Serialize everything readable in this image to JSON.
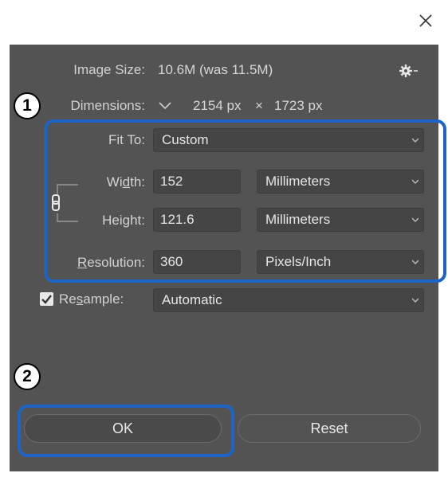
{
  "window": {
    "close_icon": "close-icon"
  },
  "image_size": {
    "label": "Image Size:",
    "value": "10.6M (was 11.5M)"
  },
  "dimensions": {
    "label": "Dimensions:",
    "width": "2154 px",
    "times": "×",
    "height": "1723 px"
  },
  "fit_to": {
    "label": "Fit To:",
    "value": "Custom"
  },
  "width": {
    "label_pre": "Wi",
    "label_u": "d",
    "label_post": "th:",
    "value": "152",
    "unit": "Millimeters"
  },
  "height": {
    "label_pre": "Hei",
    "label_u": "g",
    "label_post": "ht:",
    "value": "121.6",
    "unit": "Millimeters"
  },
  "resolution": {
    "label_pre": "",
    "label_u": "R",
    "label_post": "esolution:",
    "value": "360",
    "unit": "Pixels/Inch"
  },
  "resample": {
    "label_pre": "Re",
    "label_u": "s",
    "label_post": "ample:",
    "checked": true,
    "value": "Automatic"
  },
  "callouts": {
    "one": "1",
    "two": "2"
  },
  "buttons": {
    "ok": "OK",
    "reset": "Reset"
  },
  "colors": {
    "dialog_bg": "#535353",
    "highlight": "#1e64c8",
    "field_bg": "#454545"
  }
}
